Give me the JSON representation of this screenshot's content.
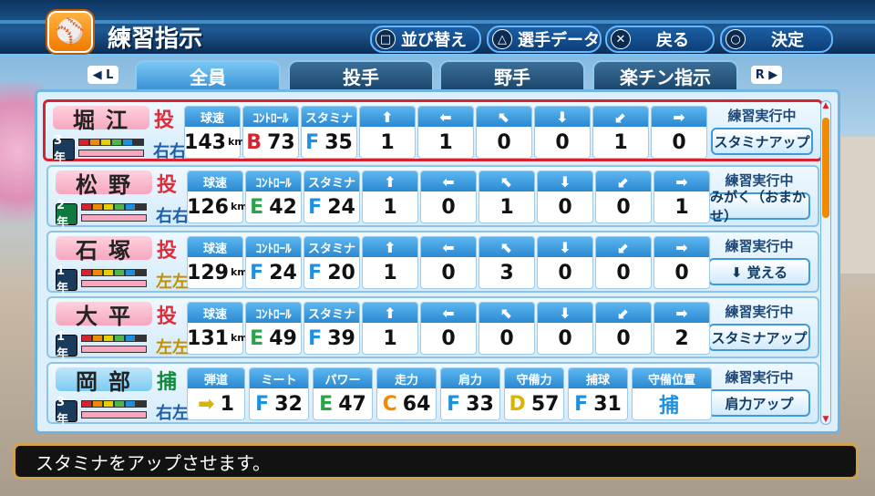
{
  "header": {
    "title": "練習指示",
    "logo_icon": "bat-ball-icon"
  },
  "buttons": [
    {
      "symbol": "□",
      "label": "並び替え"
    },
    {
      "symbol": "△",
      "label": "選手データ"
    },
    {
      "symbol": "✕",
      "label": "戻る"
    },
    {
      "symbol": "○",
      "label": "決定"
    }
  ],
  "tabs": [
    {
      "label": "全員",
      "active": true
    },
    {
      "label": "投手",
      "active": false
    },
    {
      "label": "野手",
      "active": false
    },
    {
      "label": "楽チン指示",
      "active": false
    }
  ],
  "shoulder": {
    "left": "◀ L",
    "right": "R ▶"
  },
  "pitcher_headers": {
    "speed": "球速",
    "control": "ｺﾝﾄﾛｰﾙ",
    "stamina": "スタミナ",
    "unit": "km/h"
  },
  "batter_headers": {
    "trajectory": "弾道",
    "meet": "ミート",
    "power": "パワー",
    "run": "走力",
    "arm": "肩力",
    "defense": "守備力",
    "catch": "捕球",
    "position": "守備位置"
  },
  "arrows": [
    "⬆",
    "⬅",
    "⬉",
    "⬇",
    "⬋",
    "➡"
  ],
  "players": [
    {
      "name": "堀江",
      "pos": "投",
      "grade": "3年",
      "hand": "右右",
      "speed": "143",
      "ctrl_rank": "B",
      "ctrl": "73",
      "sta_rank": "F",
      "sta": "35",
      "pitches": [
        "1",
        "1",
        "0",
        "0",
        "1",
        "0"
      ],
      "status": "練習実行中",
      "action": "スタミナアップ"
    },
    {
      "name": "松野",
      "pos": "投",
      "grade": "2年",
      "hand": "右右",
      "speed": "126",
      "ctrl_rank": "E",
      "ctrl": "42",
      "sta_rank": "F",
      "sta": "24",
      "pitches": [
        "1",
        "0",
        "1",
        "0",
        "0",
        "1"
      ],
      "status": "練習実行中",
      "action": "みがく（おまかせ）"
    },
    {
      "name": "石塚",
      "pos": "投",
      "grade": "1年",
      "hand": "左左",
      "speed": "129",
      "ctrl_rank": "F",
      "ctrl": "24",
      "sta_rank": "F",
      "sta": "20",
      "pitches": [
        "1",
        "0",
        "3",
        "0",
        "0",
        "0"
      ],
      "status": "練習実行中",
      "action": "⬇ 覚える"
    },
    {
      "name": "大平",
      "pos": "投",
      "grade": "1年",
      "hand": "左左",
      "speed": "131",
      "ctrl_rank": "E",
      "ctrl": "49",
      "sta_rank": "F",
      "sta": "39",
      "pitches": [
        "1",
        "0",
        "0",
        "0",
        "0",
        "2"
      ],
      "status": "練習実行中",
      "action": "スタミナアップ"
    }
  ],
  "batter": {
    "name": "岡部",
    "pos": "捕",
    "grade": "3年",
    "hand": "右左",
    "traj": "1",
    "meet_rank": "F",
    "meet": "32",
    "power_rank": "E",
    "power": "47",
    "run_rank": "C",
    "run": "64",
    "arm_rank": "F",
    "arm": "33",
    "def_rank": "D",
    "def": "57",
    "catch_rank": "F",
    "catch": "31",
    "position": "捕",
    "status": "練習実行中",
    "action": "肩力アップ"
  },
  "message": "スタミナをアップさせます。",
  "colors": {
    "selected": "#d8232e",
    "accent": "#2c89d1"
  }
}
